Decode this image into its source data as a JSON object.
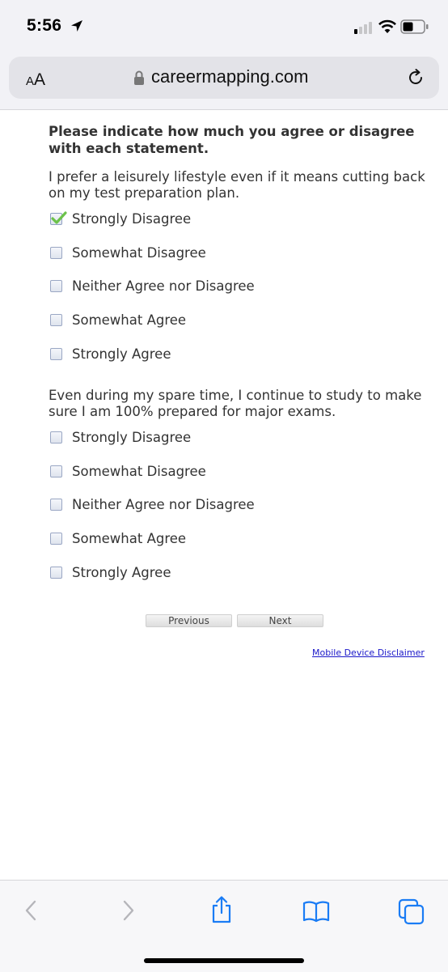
{
  "status_bar": {
    "time": "5:56"
  },
  "browser": {
    "text_size_small": "A",
    "text_size_big": "A",
    "url": "careermapping.com"
  },
  "survey": {
    "instruction": "Please indicate how much you agree or disagree with each statement.",
    "questions": [
      {
        "statement": "I prefer a leisurely lifestyle even if it means cutting back on my test preparation plan.",
        "options": [
          {
            "label": "Strongly Disagree",
            "checked": true
          },
          {
            "label": "Somewhat Disagree",
            "checked": false
          },
          {
            "label": "Neither Agree nor Disagree",
            "checked": false
          },
          {
            "label": "Somewhat Agree",
            "checked": false
          },
          {
            "label": "Strongly Agree",
            "checked": false
          }
        ]
      },
      {
        "statement": "Even during my spare time, I continue to study to make sure I am 100% prepared for major exams.",
        "options": [
          {
            "label": "Strongly Disagree",
            "checked": false
          },
          {
            "label": "Somewhat Disagree",
            "checked": false
          },
          {
            "label": "Neither Agree nor Disagree",
            "checked": false
          },
          {
            "label": "Somewhat Agree",
            "checked": false
          },
          {
            "label": "Strongly Agree",
            "checked": false
          }
        ]
      }
    ],
    "previous_label": "Previous",
    "next_label": "Next",
    "disclaimer_link": "Mobile Device Disclaimer"
  },
  "colors": {
    "accent": "#1a7cf5",
    "link": "#1a17c9",
    "check": "#6cc24a"
  }
}
